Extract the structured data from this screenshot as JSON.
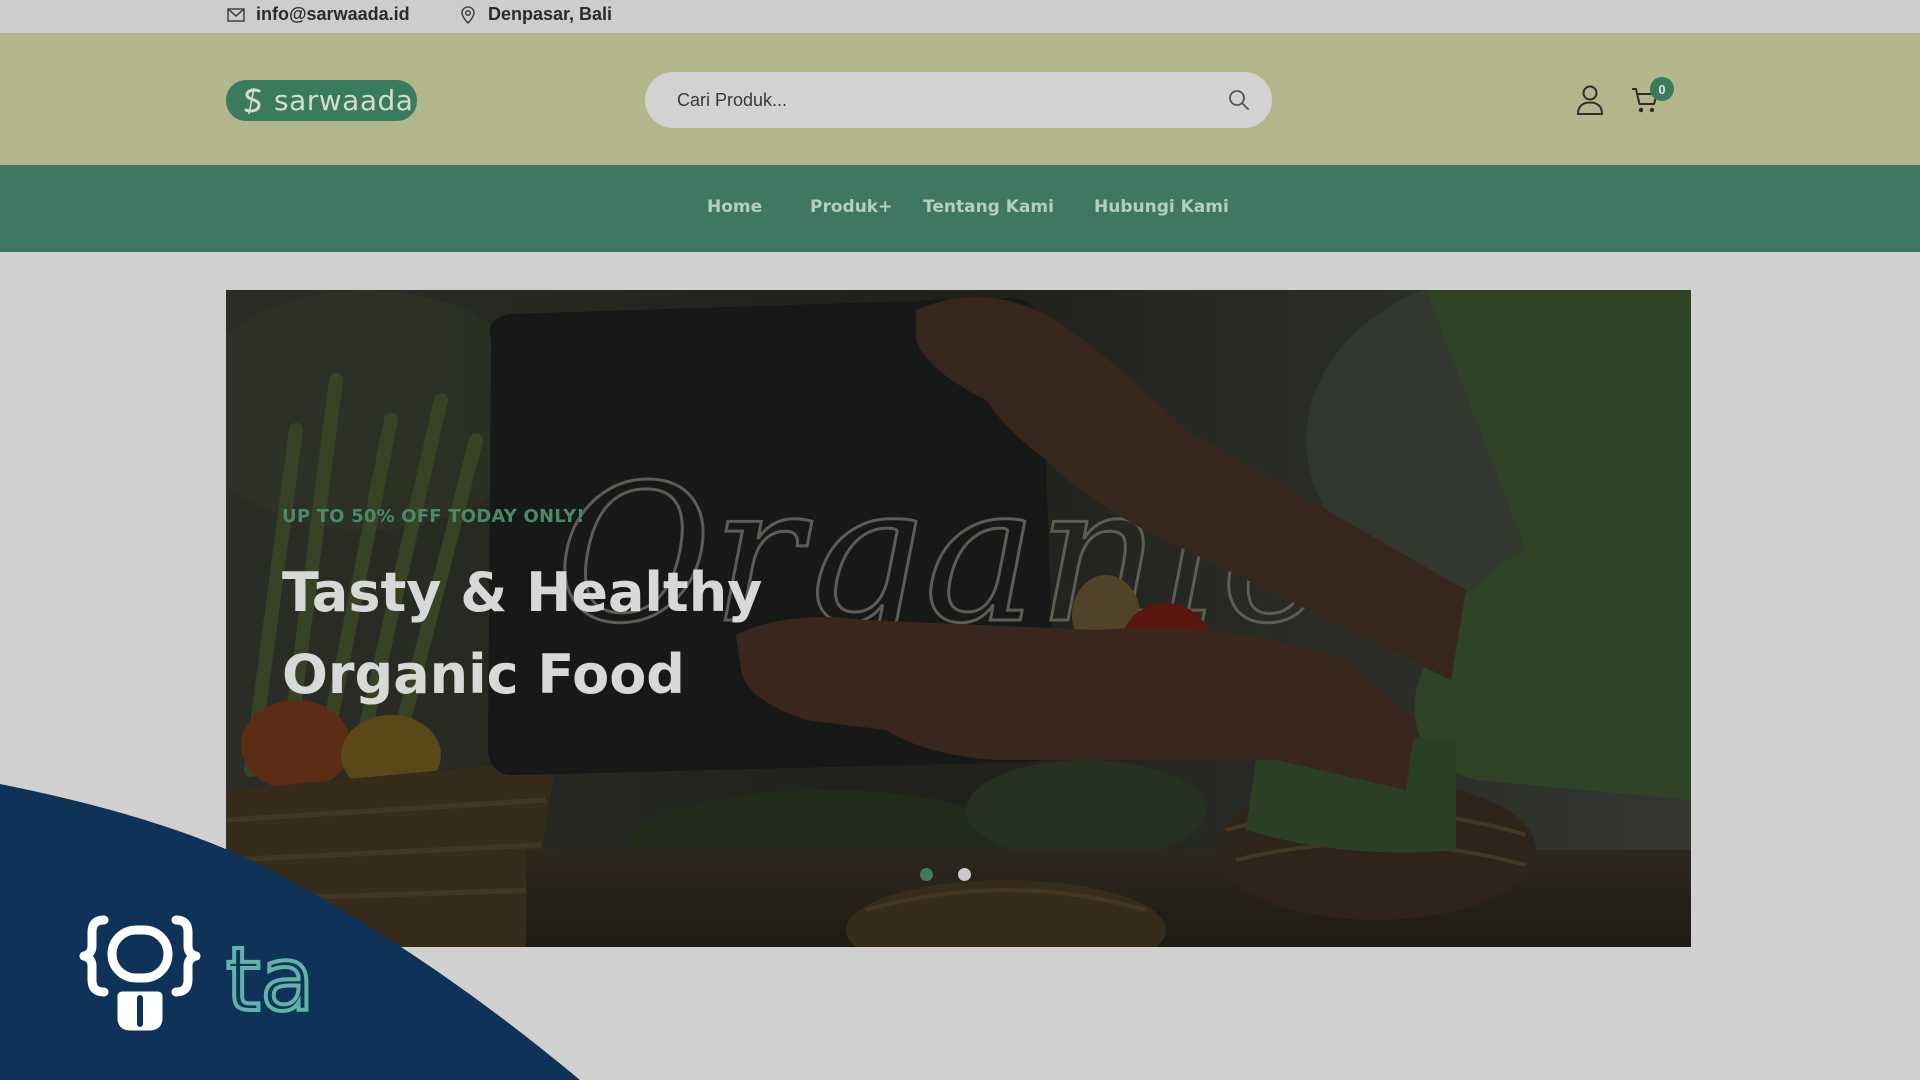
{
  "topbar": {
    "email": "info@sarwaada.id",
    "location": "Denpasar, Bali"
  },
  "header": {
    "logo_text": "sarwaada",
    "search_placeholder": "Cari Produk...",
    "cart_count": "0"
  },
  "nav": {
    "items": [
      {
        "label": "Home"
      },
      {
        "label": "Produk+"
      },
      {
        "label": "Tentang Kami"
      },
      {
        "label": "Hubungi Kami"
      }
    ]
  },
  "hero": {
    "eyebrow": "UP TO 50% OFF TODAY ONLY!",
    "title_line1": "Tasty & Healthy",
    "title_line2": "Organic Food",
    "sign_text": "Organic",
    "active_slide": 1,
    "slide_count": 2
  },
  "overlay": {
    "logo_text": "ta"
  },
  "colors": {
    "header_bg": "#b3b68a",
    "nav_bg": "#3f7763",
    "accent_green": "#3a7a5e",
    "overlay_navy": "#0f3358"
  },
  "icons": {
    "email": "mail-icon",
    "location": "map-pin-icon",
    "search": "search-icon",
    "user": "user-icon",
    "cart": "cart-icon"
  }
}
